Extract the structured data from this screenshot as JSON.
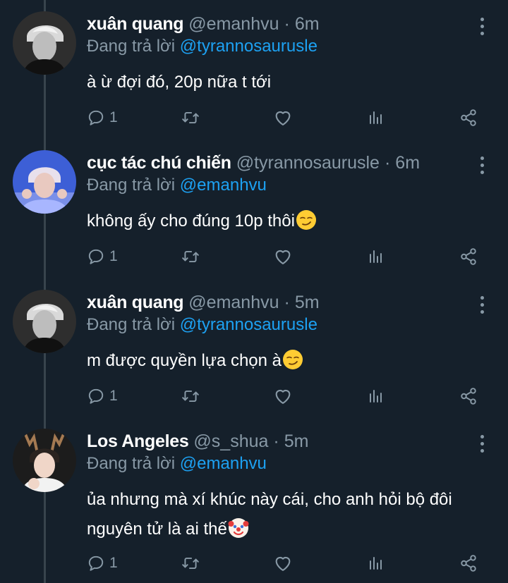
{
  "tweets": [
    {
      "name": "xuân quang",
      "handle": "@emanhvu",
      "time": "6m",
      "replying_label": "Đang trả lời",
      "replying_to": "@tyrannosaurusle",
      "text": "à ừ đợi đó, 20p nữa t tới",
      "emoji": "",
      "reply_count": "1",
      "avatar": "grayscale-man-avatar"
    },
    {
      "name": "cục tác chú chiến",
      "handle": "@tyrannosaurusle",
      "time": "6m",
      "replying_label": "Đang trả lời",
      "replying_to": "@emanhvu",
      "text": "không ấy cho đúng 10p thôi",
      "emoji": "smirk",
      "reply_count": "1",
      "avatar": "blue-portrait-avatar"
    },
    {
      "name": "xuân quang",
      "handle": "@emanhvu",
      "time": "5m",
      "replying_label": "Đang trả lời",
      "replying_to": "@tyrannosaurusle",
      "text": "m được quyền lựa chọn à",
      "emoji": "smirk",
      "reply_count": "1",
      "avatar": "grayscale-man-avatar"
    },
    {
      "name": "Los Angeles",
      "handle": "@s_shua",
      "time": "5m",
      "replying_label": "Đang trả lời",
      "replying_to": "@emanhvu",
      "text_line1": "ủa nhưng mà xí khúc này cái, cho anh hỏi bộ đôi",
      "text_line2": "nguyên tử là ai thế",
      "emoji": "clown",
      "reply_count": "1",
      "avatar": "reindeer-antlers-avatar"
    }
  ],
  "separator": "·",
  "colors": {
    "background": "#15202b",
    "muted": "#8899a6",
    "link": "#1da1f2",
    "thread_line": "#38444d"
  }
}
